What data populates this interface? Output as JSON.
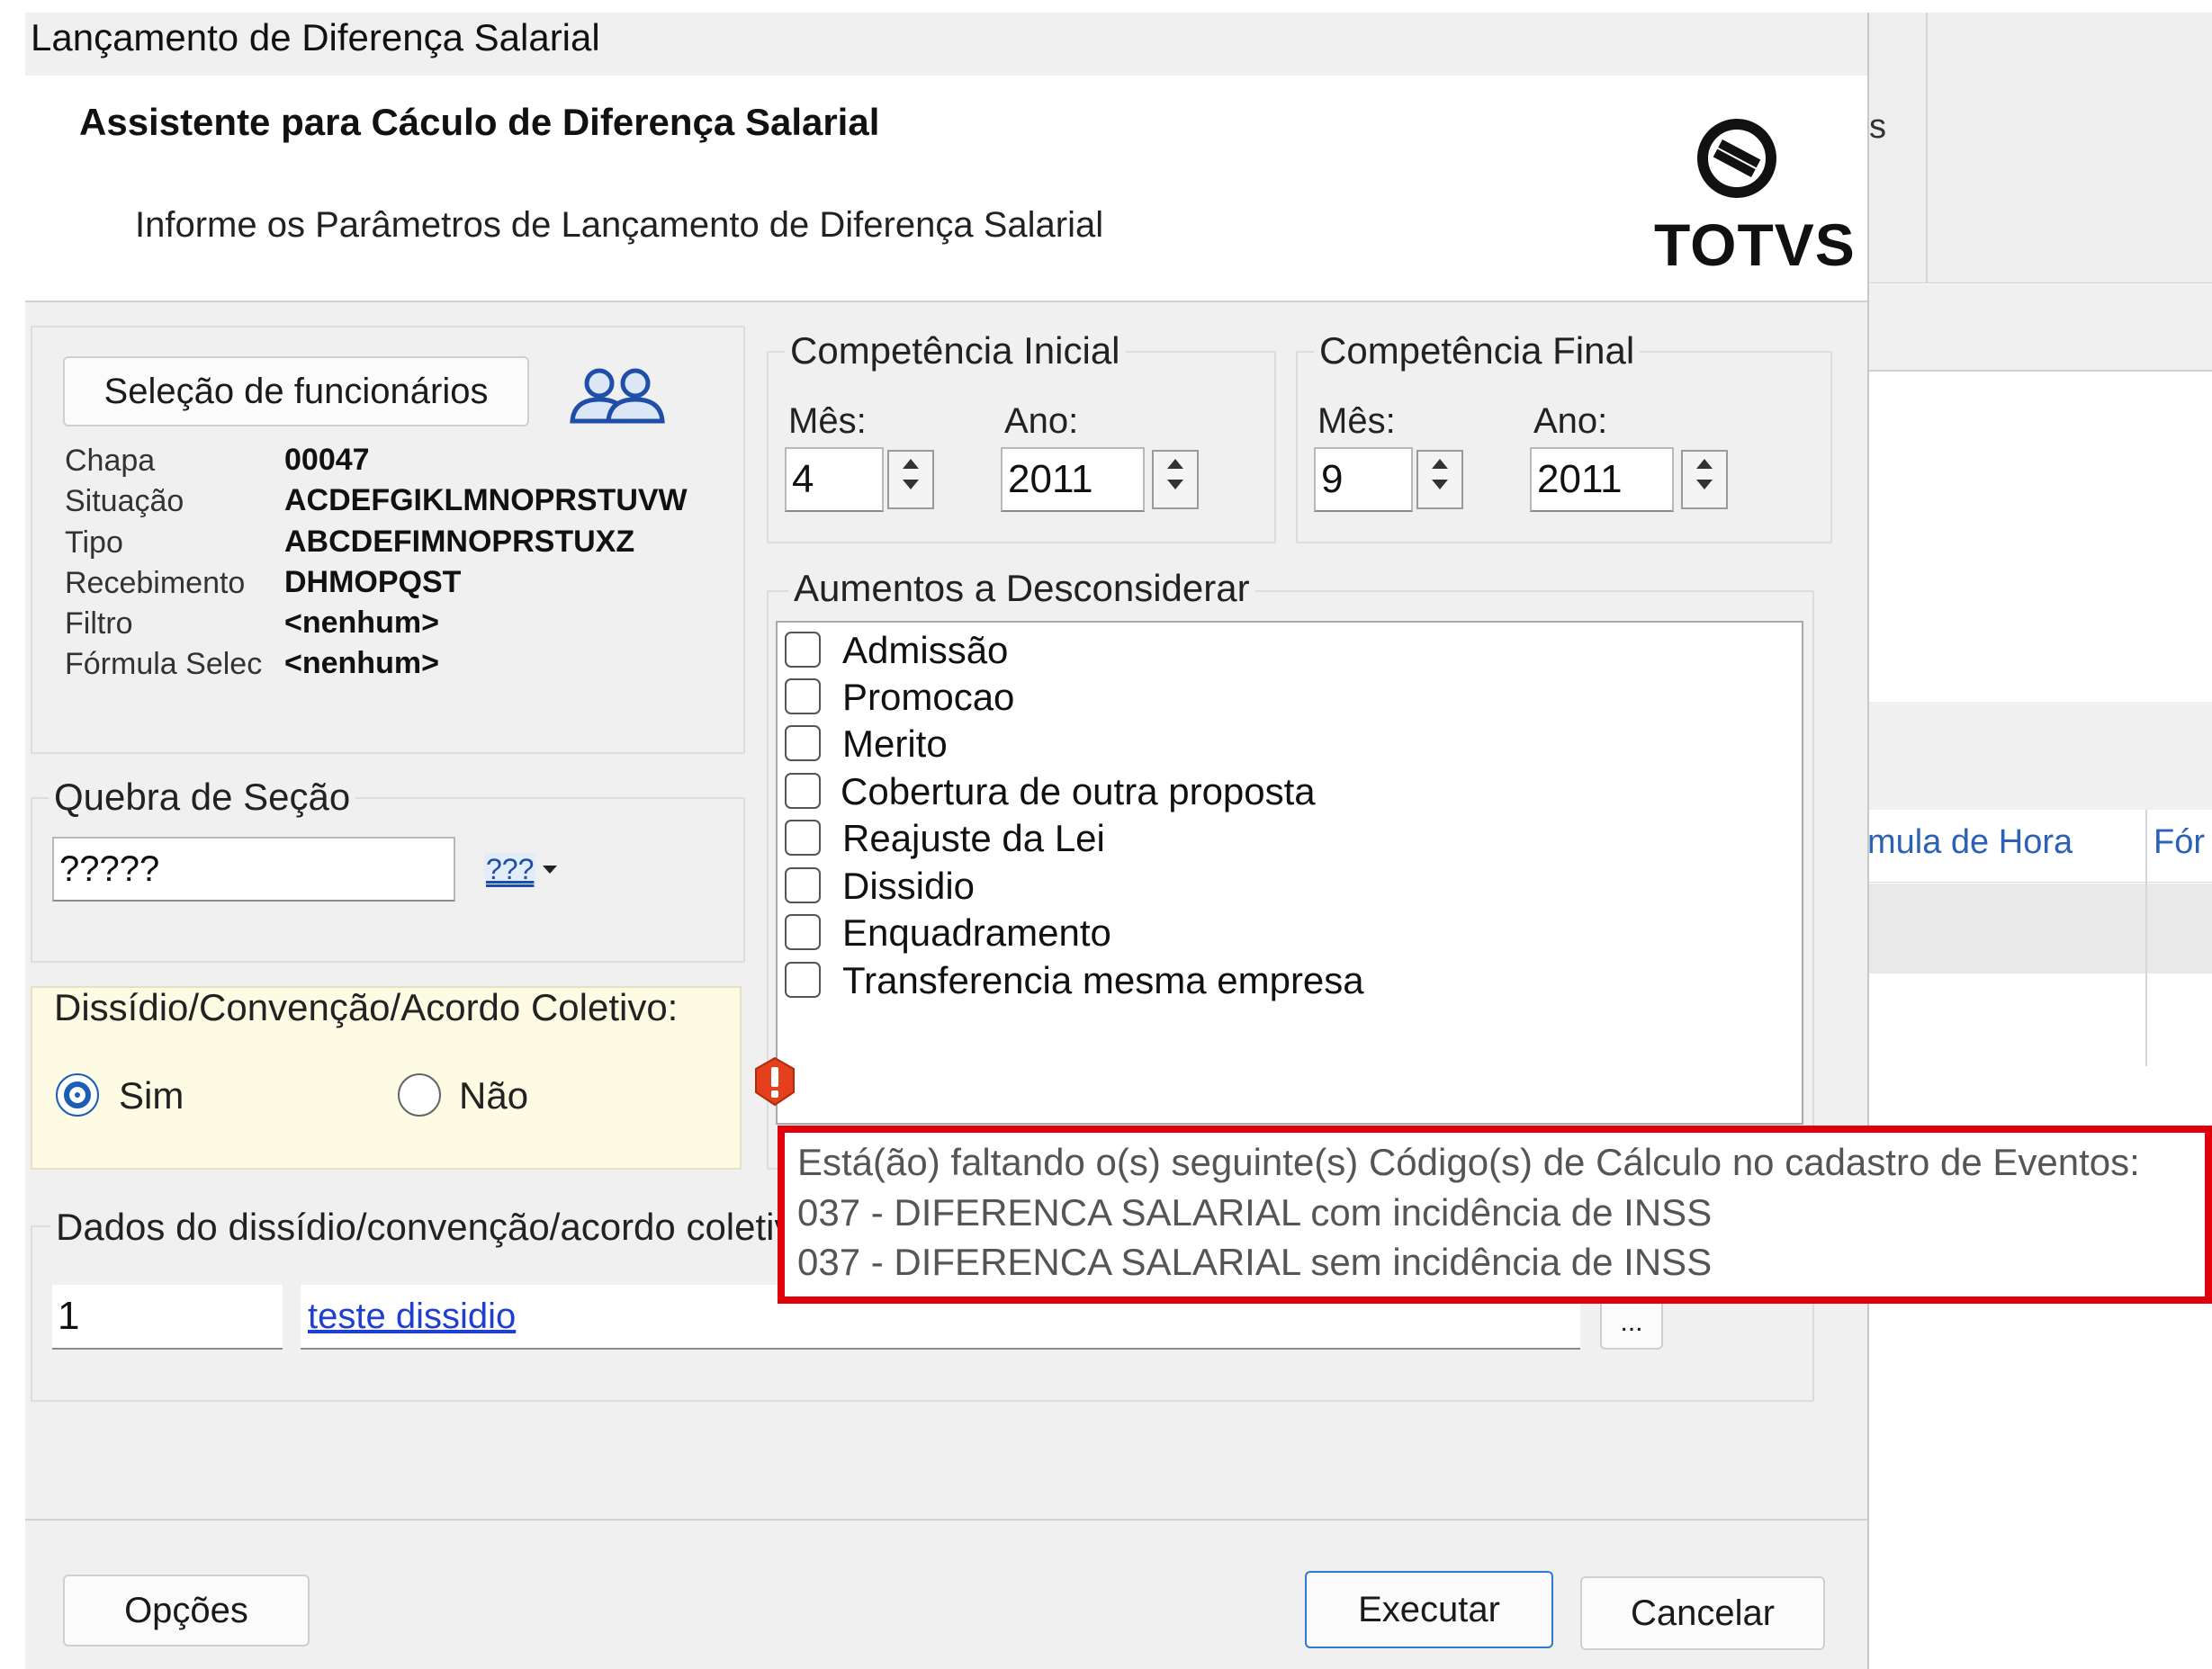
{
  "window": {
    "title": "Lançamento de Diferença Salarial"
  },
  "header": {
    "title": "Assistente para Cáculo de Diferença Salarial",
    "subtitle": "Informe os Parâmetros de Lançamento de Diferença Salarial",
    "logo_text": "TOTVS"
  },
  "background_app": {
    "toolbar_fragment": "s",
    "columns": [
      "mula de Hora",
      "Fór"
    ]
  },
  "selection": {
    "button_label": "Seleção de funcionários",
    "fields": [
      {
        "label": "Chapa",
        "value": "00047"
      },
      {
        "label": "Situação",
        "value": "ACDEFGIKLMNOPRSTUVW"
      },
      {
        "label": "Tipo",
        "value": "ABCDEFIMNOPRSTUXZ"
      },
      {
        "label": "Recebimento",
        "value": "DHMOPQST"
      },
      {
        "label": "Filtro",
        "value": "<nenhum>"
      },
      {
        "label": "Fórmula Selec",
        "value": "<nenhum>"
      }
    ]
  },
  "quebra": {
    "legend": "Quebra de Seção",
    "value": "?????",
    "button_label": "???"
  },
  "dissidio": {
    "legend": "Dissídio/Convenção/Acordo Coletivo:",
    "options": [
      "Sim",
      "Não"
    ],
    "selected": "Sim"
  },
  "dados": {
    "legend": "Dados do dissídio/convenção/acordo coletivo",
    "code": "1",
    "description": "teste dissidio",
    "browse_label": "..."
  },
  "competencia_inicial": {
    "legend": "Competência Inicial",
    "mes_label": "Mês:",
    "mes": "4",
    "ano_label": "Ano:",
    "ano": "2011"
  },
  "competencia_final": {
    "legend": "Competência Final",
    "mes_label": "Mês:",
    "mes": "9",
    "ano_label": "Ano:",
    "ano": "2011"
  },
  "aumentos": {
    "legend": "Aumentos a Desconsiderar",
    "items": [
      "Admissão",
      "Promocao",
      "Merito",
      "Cobertura de outra proposta",
      "Reajuste da Lei",
      "Dissidio",
      "Enquadramento",
      "Transferencia mesma empresa"
    ]
  },
  "tooltip": {
    "lines": [
      "Está(ão) faltando o(s) seguinte(s) Código(s) de Cálculo no cadastro de Eventos:",
      "037 - DIFERENCA SALARIAL com incidência de INSS",
      "037 - DIFERENCA SALARIAL sem incidência de INSS"
    ]
  },
  "footer": {
    "options_label": "Opções",
    "execute_label": "Executar",
    "cancel_label": "Cancelar"
  },
  "colors": {
    "accent": "#1a5fb4",
    "link": "#1f3fd1",
    "error_border": "#e0000b",
    "error_icon": "#e5401d",
    "dissidio_bg": "#fdfbe3"
  }
}
